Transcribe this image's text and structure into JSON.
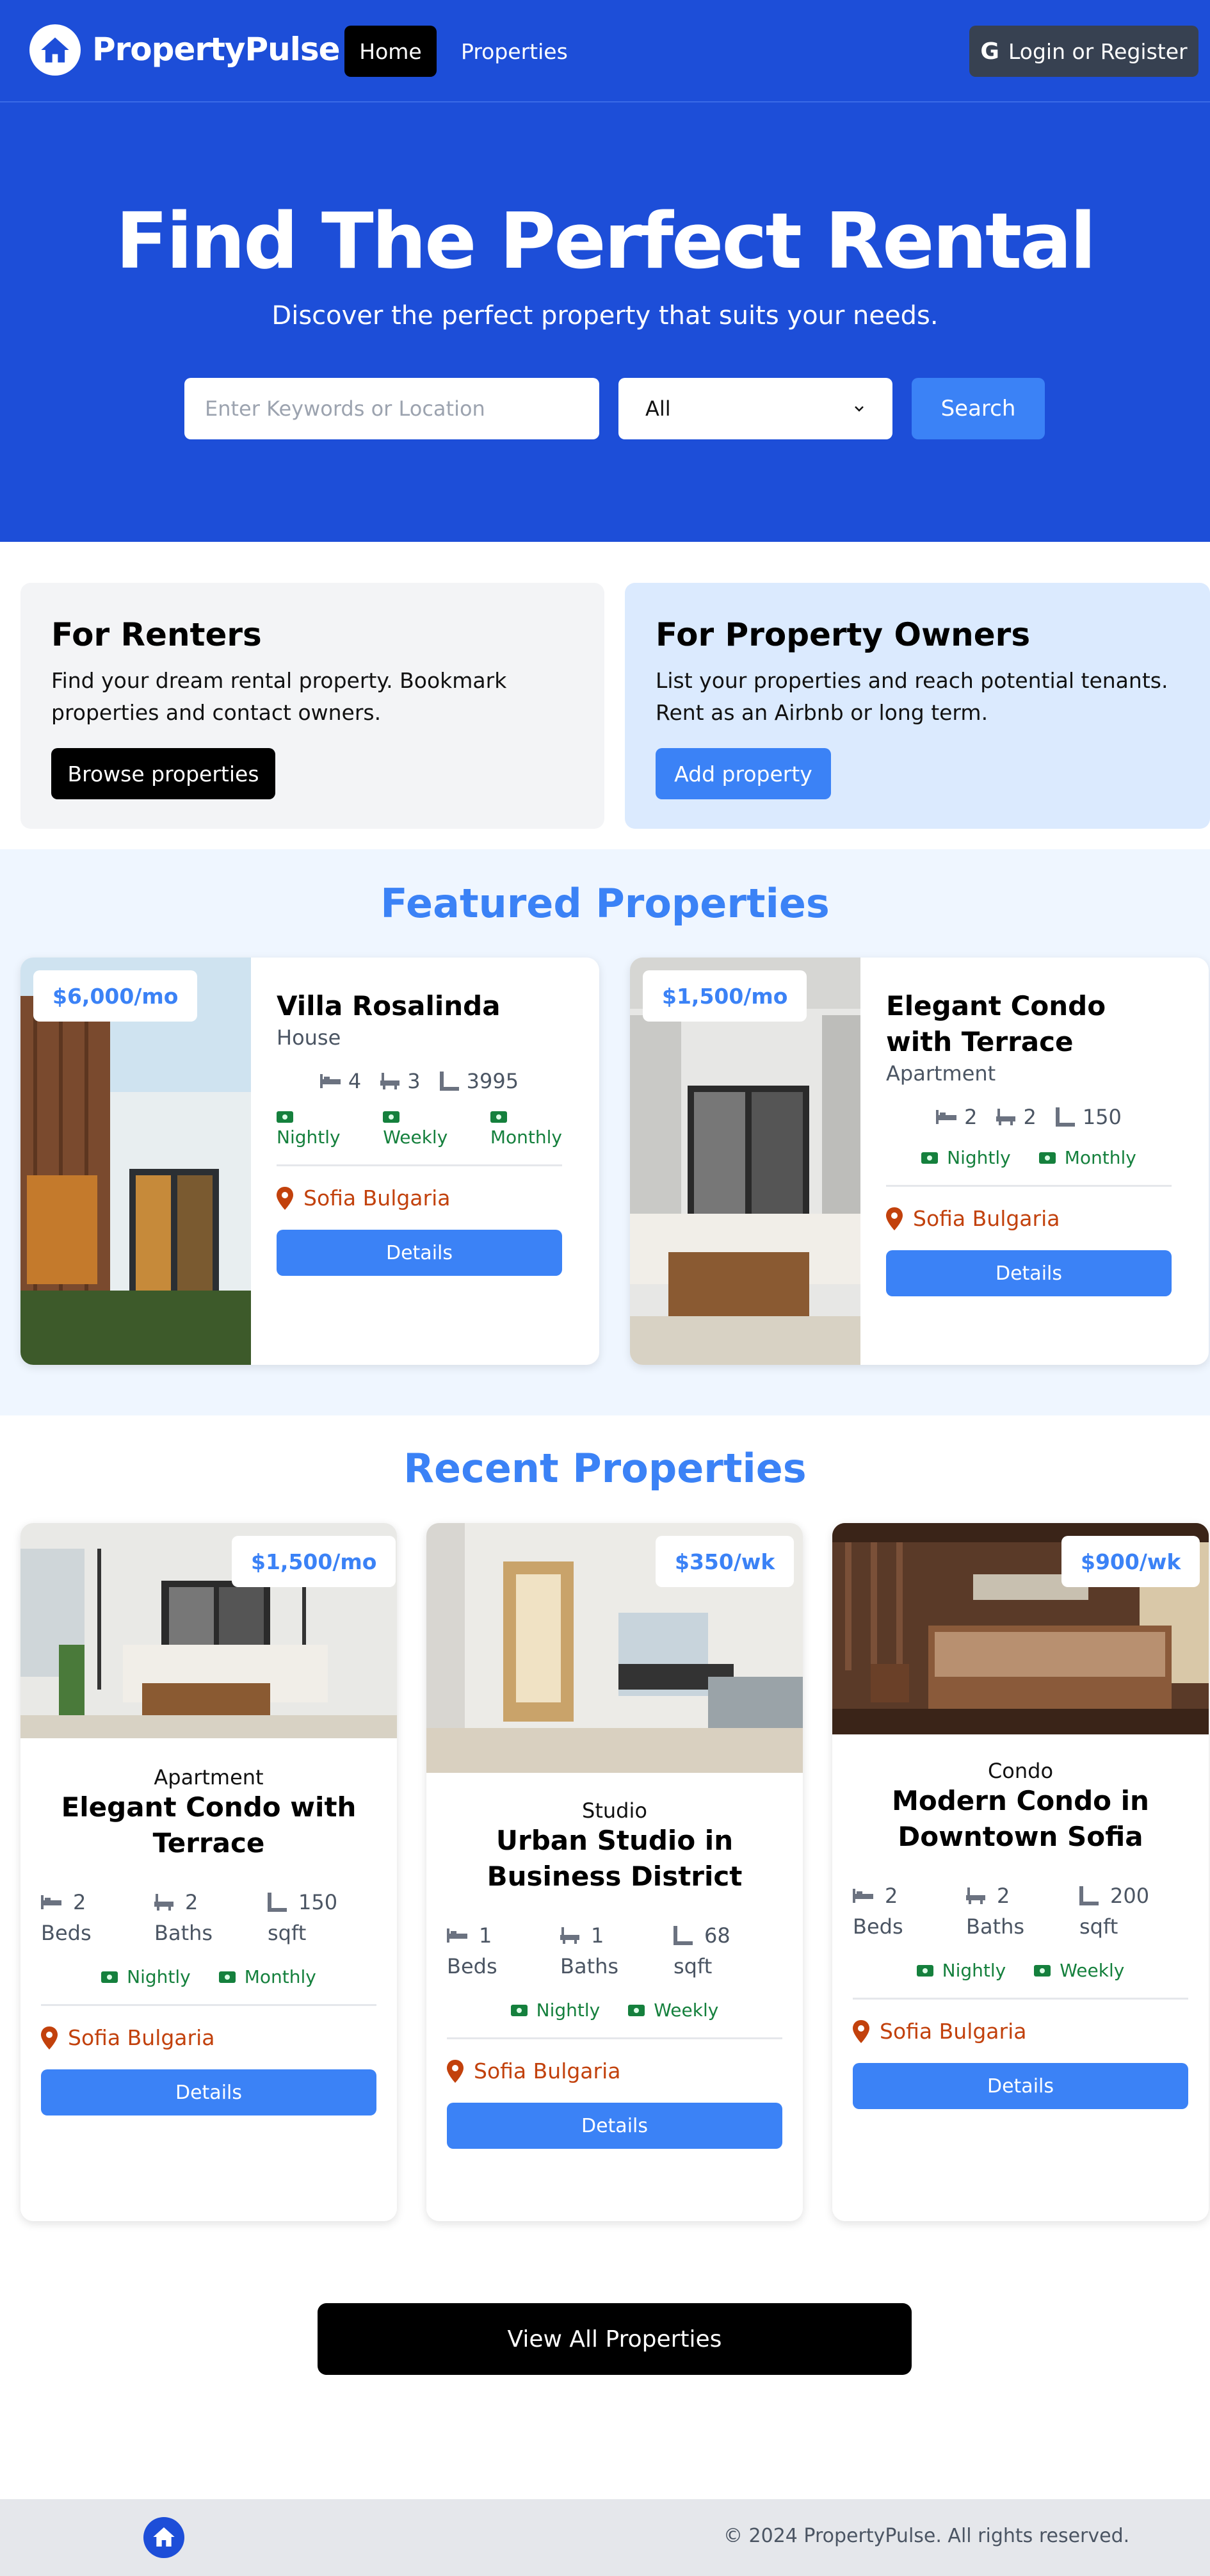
{
  "nav": {
    "brand": "PropertyPulse",
    "home": "Home",
    "properties": "Properties",
    "login": "Login or Register"
  },
  "hero": {
    "title": "Find The Perfect Rental",
    "subtitle": "Discover the perfect property that suits your needs.",
    "search_placeholder": "Enter Keywords or Location",
    "select_value": "All",
    "search_button": "Search"
  },
  "info": {
    "renters": {
      "title": "For Renters",
      "text": "Find your dream rental property. Bookmark properties and contact owners.",
      "button": "Browse properties"
    },
    "owners": {
      "title": "For Property Owners",
      "text": "List your properties and reach potential tenants. Rent as an Airbnb or long term.",
      "button": "Add property"
    }
  },
  "featured": {
    "title": "Featured Properties",
    "cards": [
      {
        "price": "$6,000/mo",
        "name": "Villa Rosalinda",
        "type": "House",
        "beds": "4",
        "baths": "3",
        "sqft": "3995",
        "rates": [
          "Nightly",
          "Weekly",
          "Monthly"
        ],
        "location": "Sofia Bulgaria",
        "details": "Details"
      },
      {
        "price": "$1,500/mo",
        "name": "Elegant Condo with Terrace",
        "type": "Apartment",
        "beds": "2",
        "baths": "2",
        "sqft": "150",
        "rates": [
          "Nightly",
          "Monthly"
        ],
        "location": "Sofia Bulgaria",
        "details": "Details"
      }
    ]
  },
  "recent": {
    "title": "Recent Properties",
    "beds_label": "Beds",
    "baths_label": "Baths",
    "sqft_label": "sqft",
    "cards": [
      {
        "price": "$1,500/mo",
        "type": "Apartment",
        "name": "Elegant Condo with Terrace",
        "beds": "2",
        "baths": "2",
        "sqft": "150",
        "rates": [
          "Nightly",
          "Monthly"
        ],
        "location": "Sofia Bulgaria",
        "details": "Details"
      },
      {
        "price": "$350/wk",
        "type": "Studio",
        "name": "Urban Studio in Business District",
        "beds": "1",
        "baths": "1",
        "sqft": "68",
        "rates": [
          "Nightly",
          "Weekly"
        ],
        "location": "Sofia Bulgaria",
        "details": "Details"
      },
      {
        "price": "$900/wk",
        "type": "Condo",
        "name": "Modern Condo in Downtown Sofia",
        "beds": "2",
        "baths": "2",
        "sqft": "200",
        "rates": [
          "Nightly",
          "Weekly"
        ],
        "location": "Sofia Bulgaria",
        "details": "Details"
      }
    ],
    "view_all": "View All Properties"
  },
  "footer": {
    "copyright": "© 2024 PropertyPulse. All rights reserved."
  },
  "colors": {
    "brand_blue": "#1d4ed8",
    "accent_blue": "#3b82f6",
    "location_orange": "#c2410c",
    "rate_green": "#15803d"
  }
}
